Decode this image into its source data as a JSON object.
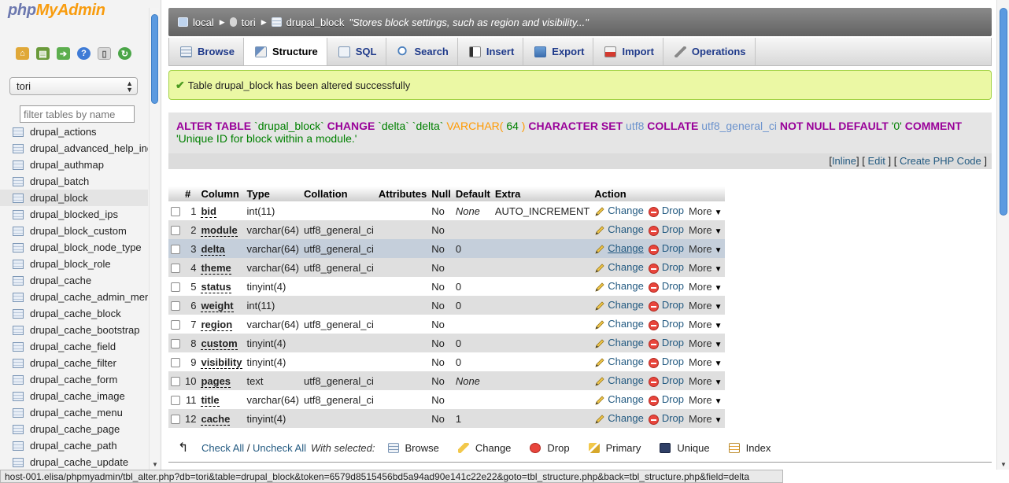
{
  "nav": {
    "logo_php": "php",
    "logo_admin": "MyAdmin",
    "db_selected": "tori",
    "filter_placeholder": "filter tables by name",
    "tables": [
      "drupal_actions",
      "drupal_advanced_help_index",
      "drupal_authmap",
      "drupal_batch",
      "drupal_block",
      "drupal_blocked_ips",
      "drupal_block_custom",
      "drupal_block_node_type",
      "drupal_block_role",
      "drupal_cache",
      "drupal_cache_admin_menu",
      "drupal_cache_block",
      "drupal_cache_bootstrap",
      "drupal_cache_field",
      "drupal_cache_filter",
      "drupal_cache_form",
      "drupal_cache_image",
      "drupal_cache_menu",
      "drupal_cache_page",
      "drupal_cache_path",
      "drupal_cache_update"
    ],
    "active_table": "drupal_block"
  },
  "breadcrumb": {
    "server": "local",
    "database": "tori",
    "table": "drupal_block",
    "comment": "\"Stores block settings, such as region and visibility...\""
  },
  "tabs": [
    "Browse",
    "Structure",
    "SQL",
    "Search",
    "Insert",
    "Export",
    "Import",
    "Operations"
  ],
  "active_tab": "Structure",
  "success_message": "Table drupal_block has been altered successfully",
  "sql": {
    "kw1": "ALTER TABLE",
    "tbl": "`drupal_block`",
    "kw2": "CHANGE",
    "col1": "`delta`",
    "col2": "`delta`",
    "fn": "VARCHAR(",
    "len": "64",
    "close": ")",
    "kw3": "CHARACTER SET",
    "charset": "utf8",
    "kw4": "COLLATE",
    "collation": "utf8_general_ci",
    "kw5": "NOT NULL DEFAULT",
    "default": "'0'",
    "kw6": "COMMENT",
    "comment": "'Unique ID for block within a module.'"
  },
  "sql_links": {
    "inline": "Inline",
    "edit": "Edit",
    "php": "Create PHP Code"
  },
  "table_headers": [
    "#",
    "Column",
    "Type",
    "Collation",
    "Attributes",
    "Null",
    "Default",
    "Extra",
    "Action"
  ],
  "columns": [
    {
      "num": "1",
      "name": "bid",
      "type": "int(11)",
      "collation": "",
      "attributes": "",
      "null": "No",
      "default": "None",
      "extra": "AUTO_INCREMENT"
    },
    {
      "num": "2",
      "name": "module",
      "type": "varchar(64)",
      "collation": "utf8_general_ci",
      "attributes": "",
      "null": "No",
      "default": "",
      "extra": ""
    },
    {
      "num": "3",
      "name": "delta",
      "type": "varchar(64)",
      "collation": "utf8_general_ci",
      "attributes": "",
      "null": "No",
      "default": "0",
      "extra": ""
    },
    {
      "num": "4",
      "name": "theme",
      "type": "varchar(64)",
      "collation": "utf8_general_ci",
      "attributes": "",
      "null": "No",
      "default": "",
      "extra": ""
    },
    {
      "num": "5",
      "name": "status",
      "type": "tinyint(4)",
      "collation": "",
      "attributes": "",
      "null": "No",
      "default": "0",
      "extra": ""
    },
    {
      "num": "6",
      "name": "weight",
      "type": "int(11)",
      "collation": "",
      "attributes": "",
      "null": "No",
      "default": "0",
      "extra": ""
    },
    {
      "num": "7",
      "name": "region",
      "type": "varchar(64)",
      "collation": "utf8_general_ci",
      "attributes": "",
      "null": "No",
      "default": "",
      "extra": ""
    },
    {
      "num": "8",
      "name": "custom",
      "type": "tinyint(4)",
      "collation": "",
      "attributes": "",
      "null": "No",
      "default": "0",
      "extra": ""
    },
    {
      "num": "9",
      "name": "visibility",
      "type": "tinyint(4)",
      "collation": "",
      "attributes": "",
      "null": "No",
      "default": "0",
      "extra": ""
    },
    {
      "num": "10",
      "name": "pages",
      "type": "text",
      "collation": "utf8_general_ci",
      "attributes": "",
      "null": "No",
      "default": "None",
      "extra": ""
    },
    {
      "num": "11",
      "name": "title",
      "type": "varchar(64)",
      "collation": "utf8_general_ci",
      "attributes": "",
      "null": "No",
      "default": "",
      "extra": ""
    },
    {
      "num": "12",
      "name": "cache",
      "type": "tinyint(4)",
      "collation": "",
      "attributes": "",
      "null": "No",
      "default": "1",
      "extra": ""
    }
  ],
  "highlighted_row": "3",
  "row_actions": {
    "change": "Change",
    "drop": "Drop",
    "more": "More"
  },
  "with_selected": {
    "check_all": "Check All",
    "slash": " / ",
    "uncheck_all": "Uncheck All",
    "label": "With selected:",
    "actions": [
      "Browse",
      "Change",
      "Drop",
      "Primary",
      "Unique",
      "Index"
    ]
  },
  "status_bar": "host-001.elisa/phpmyadmin/tbl_alter.php?db=tori&table=drupal_block&token=6579d8515456bd5a94ad90e141c22e22&goto=tbl_structure.php&back=tbl_structure.php&field=delta",
  "colors": {
    "link": "#235a81",
    "success_bg": "#ebf8a4",
    "keyword": "#990099",
    "logo_php": "#6c78af",
    "logo_admin": "#f89c0e"
  }
}
